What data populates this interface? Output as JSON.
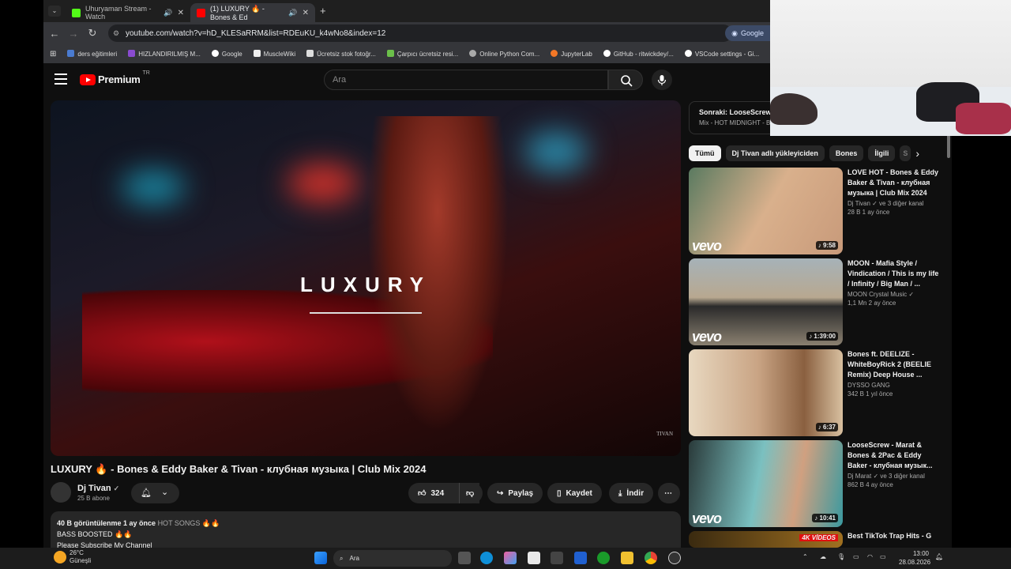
{
  "browser": {
    "tabs": [
      {
        "title": "Uhuryaman Stream - Watch",
        "color": "#53fc18"
      },
      {
        "title": "(1) LUXURY 🔥 - Bones & Ed",
        "color": "#ff0000"
      }
    ],
    "url": "youtube.com/watch?v=hD_KLESaRRM&list=RDEuKU_k4wNo8&index=12",
    "google_button": "Google",
    "bookmarks": [
      "ders eğitimleri",
      "HIZLANDIRILMIŞ M...",
      "Google",
      "MuscleWiki",
      "Ücretsiz stok fotoğr...",
      "Çarpıcı ücretsiz resi...",
      "Online Python Com...",
      "JupyterLab",
      "GitHub - ritwickdey/...",
      "VSCode settings - Gi..."
    ]
  },
  "youtube": {
    "logo_text": "Premium",
    "logo_region": "TR",
    "search_placeholder": "Ara",
    "video": {
      "overlay_title": "LUXURY",
      "watermark": "TIVAN",
      "title": "LUXURY 🔥 - Bones & Eddy Baker & Tivan - клубная музыка | Club Mix 2024",
      "channel": "Dj Tivan",
      "subscribers": "25 B abone",
      "likes": "324",
      "share": "Paylaş",
      "save": "Kaydet",
      "download": "İndir",
      "description": {
        "meta": "40 B görüntülenme  1 ay önce",
        "tags": "HOT SONGS 🔥🔥",
        "line1": "BASS BOOSTED 🔥🔥",
        "line2": "Please Subscribe My Channel"
      }
    },
    "next": {
      "label": "Sonraki: LooseScrew",
      "sub": "Mix - HOT MIDNIGHT - Bo"
    },
    "chips": [
      "Tümü",
      "Dj Tivan adlı yükleyiciden",
      "Bones",
      "İlgili",
      "S"
    ],
    "recommendations": [
      {
        "title": "LOVE HOT - Bones & Eddy Baker & Tivan - клубная музыка | Club Mix 2024",
        "channel": "Dj Tivan ✓ ve 3 diğer kanal",
        "meta": "28 B  1 ay önce",
        "duration": "9:58",
        "vevo": "vevo"
      },
      {
        "title": "MOON - Mafia Style / Vindication / This is my life / Infinity / Big Man / ...",
        "channel": "MOON Crystal Music ✓",
        "meta": "1,1 Mn  2 ay önce",
        "duration": "1:39:00",
        "vevo": "vevo"
      },
      {
        "title": "Bones ft. DEELIZE - WhiteBoyRick 2 (BEELIE Remix) Deep House ...",
        "channel": "DYSSO GANG",
        "meta": "342 B  1 yıl önce",
        "duration": "6:37",
        "vevo": ""
      },
      {
        "title": "LooseScrew - Marat & Bones & 2Pac & Eddy Baker - клубная музык...",
        "channel": "Dj Marat ✓ ve 3 diğer kanal",
        "meta": "862 B  4 ay önce",
        "duration": "10:41",
        "vevo": "vevo"
      },
      {
        "title": "Best TikTok Trap Hits - G",
        "channel": "",
        "meta": "",
        "duration": "",
        "badge": "4K VİDEOS"
      }
    ]
  },
  "taskbar": {
    "weather_temp": "26°C",
    "weather_desc": "Güneşli",
    "search": "Ara",
    "time": "13:00",
    "date": "28.08.2026"
  }
}
